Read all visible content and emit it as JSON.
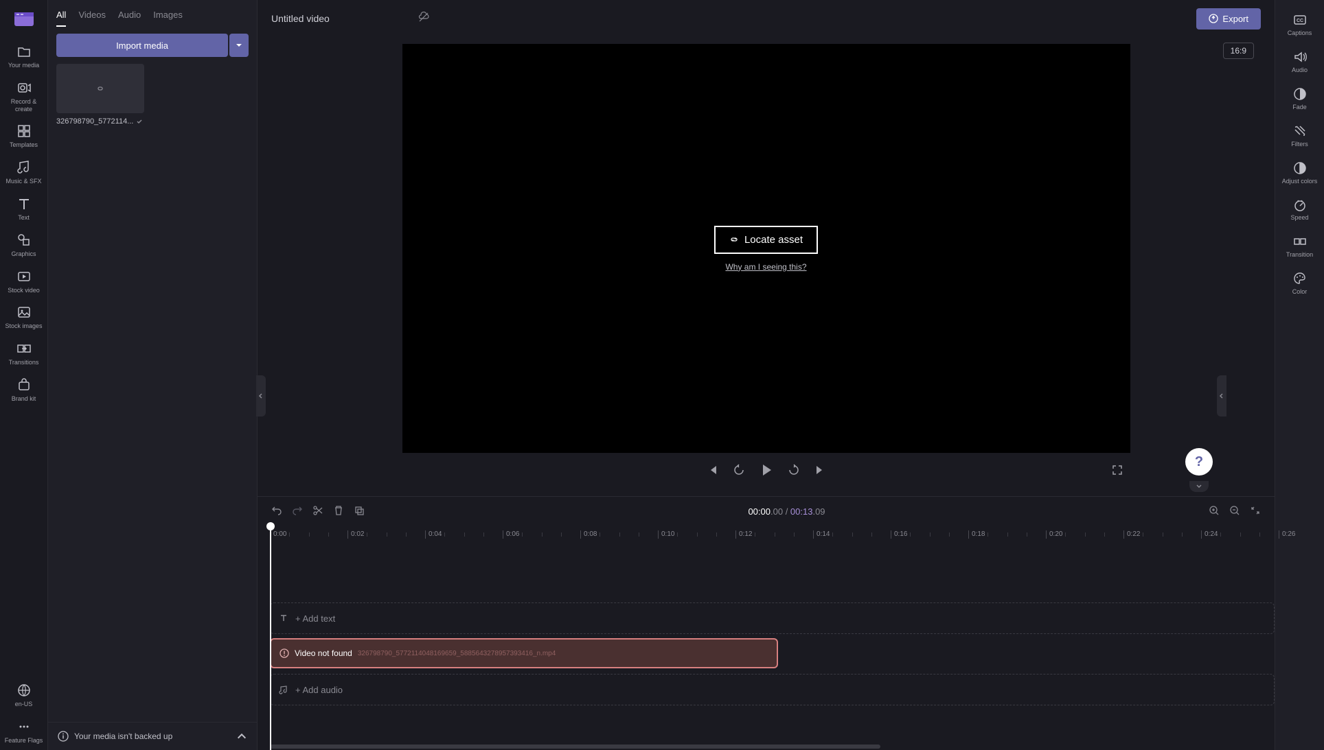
{
  "leftRail": {
    "items": [
      {
        "name": "your-media",
        "label": "Your media"
      },
      {
        "name": "record-create",
        "label": "Record & create"
      },
      {
        "name": "templates",
        "label": "Templates"
      },
      {
        "name": "music-sfx",
        "label": "Music & SFX"
      },
      {
        "name": "text",
        "label": "Text"
      },
      {
        "name": "graphics",
        "label": "Graphics"
      },
      {
        "name": "stock-video",
        "label": "Stock video"
      },
      {
        "name": "stock-images",
        "label": "Stock images"
      },
      {
        "name": "transitions",
        "label": "Transitions"
      },
      {
        "name": "brand-kit",
        "label": "Brand kit"
      }
    ],
    "bottom": [
      {
        "name": "locale",
        "label": "en-US"
      },
      {
        "name": "feature-flags",
        "label": "Feature Flags"
      }
    ]
  },
  "mediaPanel": {
    "tabs": [
      "All",
      "Videos",
      "Audio",
      "Images"
    ],
    "activeTab": 0,
    "importLabel": "Import media",
    "items": [
      {
        "label": "326798790_5772114..."
      }
    ],
    "backupMsg": "Your media isn't backed up"
  },
  "topbar": {
    "title": "Untitled video",
    "exportLabel": "Export"
  },
  "preview": {
    "aspect": "16:9",
    "locateLabel": "Locate asset",
    "whyLink": "Why am I seeing this?"
  },
  "timeline": {
    "currentMain": "00:00",
    "currentSub": ".00",
    "durationMain": "00:13",
    "durationSub": ".09",
    "ticksCount": 13,
    "addText": "+ Add text",
    "addAudio": "+ Add audio",
    "videoNotFound": "Video not found",
    "videoFile": "326798790_5772114048169659_5885643278957393416_n.mp4"
  },
  "rightRail": {
    "items": [
      {
        "name": "captions",
        "label": "Captions"
      },
      {
        "name": "audio",
        "label": "Audio"
      },
      {
        "name": "fade",
        "label": "Fade"
      },
      {
        "name": "filters",
        "label": "Filters"
      },
      {
        "name": "adjust-colors",
        "label": "Adjust colors"
      },
      {
        "name": "speed",
        "label": "Speed"
      },
      {
        "name": "transition",
        "label": "Transition"
      },
      {
        "name": "color",
        "label": "Color"
      }
    ]
  }
}
